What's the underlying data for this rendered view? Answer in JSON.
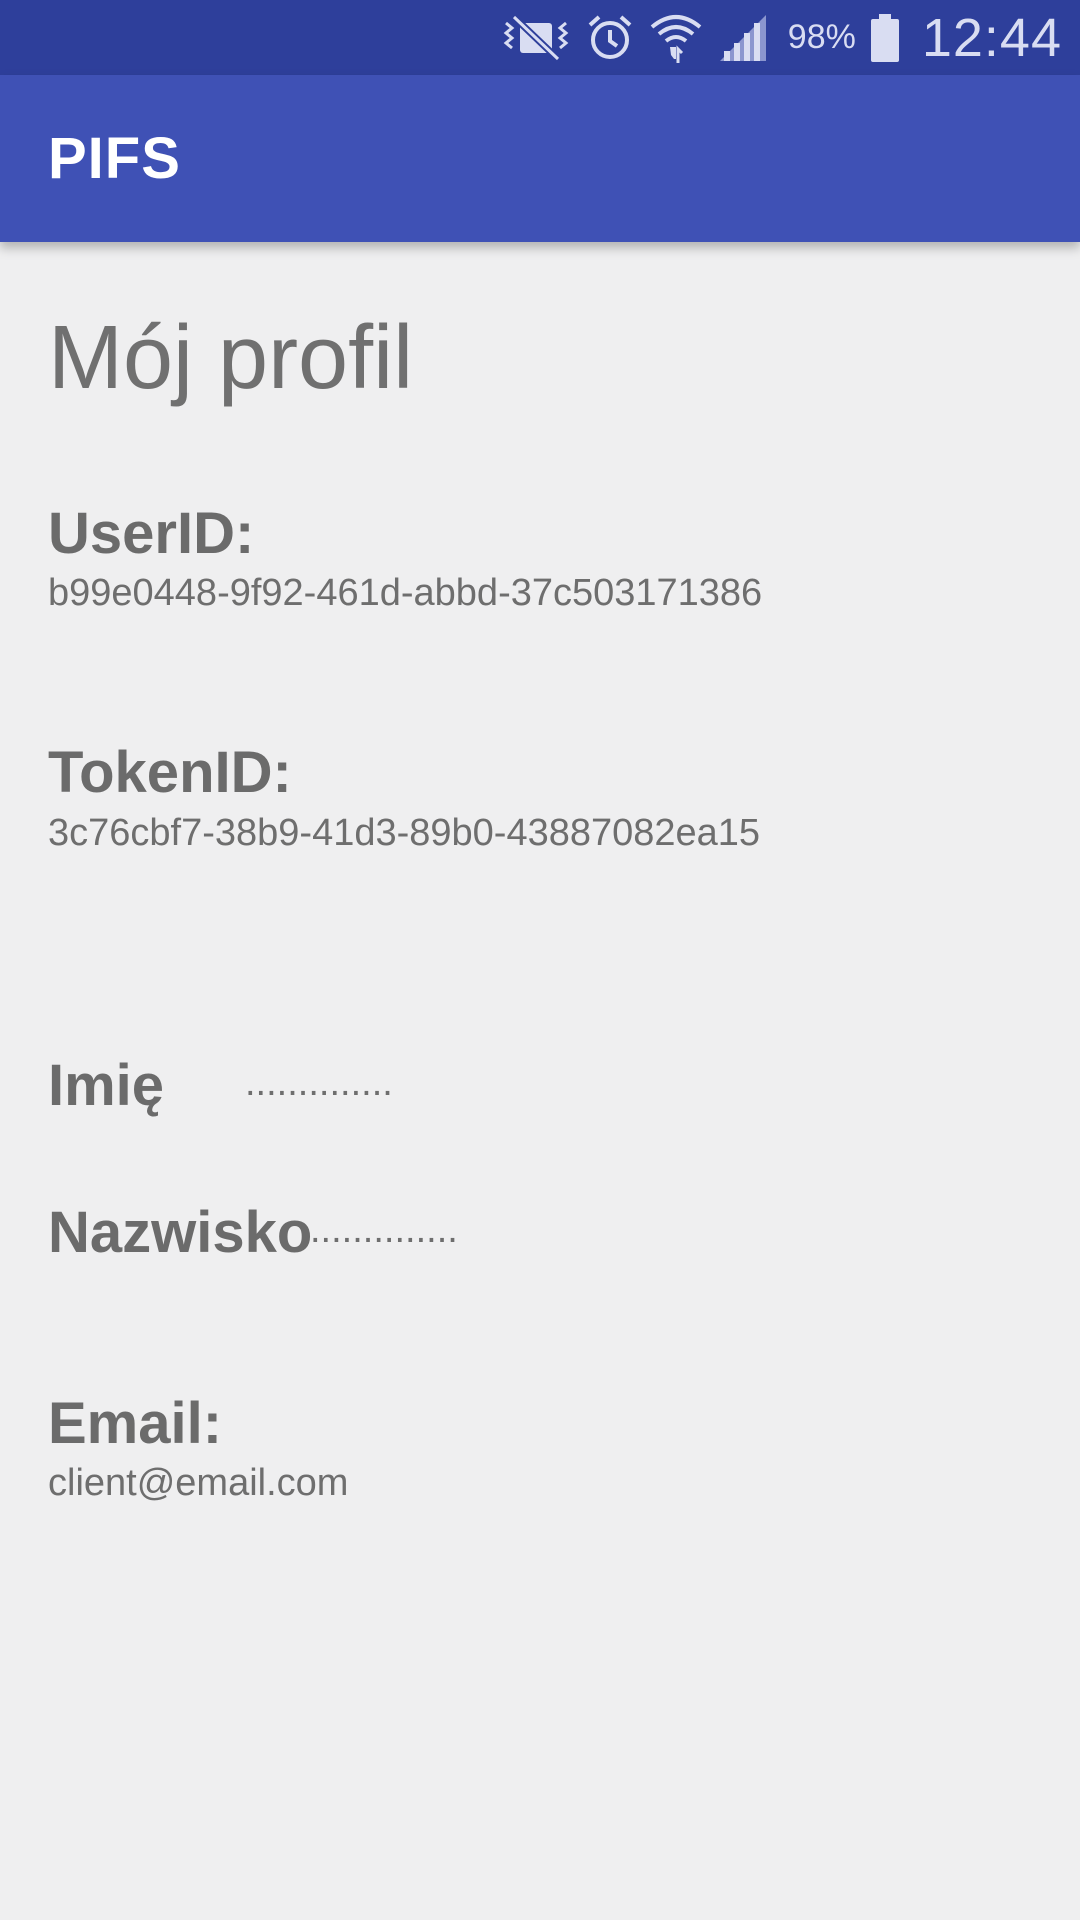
{
  "status_bar": {
    "battery_percent": "98%",
    "time": "12:44",
    "icons": [
      "vibrate-mute-icon",
      "alarm-icon",
      "wifi-icon",
      "signal-icon",
      "battery-icon"
    ]
  },
  "app_bar": {
    "title": "PIFS"
  },
  "profile": {
    "page_title": "Mój profil",
    "user_id_label": "UserID:",
    "user_id_value": "b99e0448-9f92-461d-abbd-37c503171386",
    "token_id_label": "TokenID:",
    "token_id_value": "3c76cbf7-38b9-41d3-89b0-43887082ea15",
    "first_name_label": "Imię",
    "first_name_value": "..............",
    "last_name_label": "Nazwisko",
    "last_name_value": "..............",
    "email_label": "Email:",
    "email_value": "client@email.com"
  },
  "colors": {
    "status_bar": "#2e3f9b",
    "app_bar": "#3f51b5",
    "background": "#efeff0",
    "text_gray": "#6b6b6b"
  }
}
